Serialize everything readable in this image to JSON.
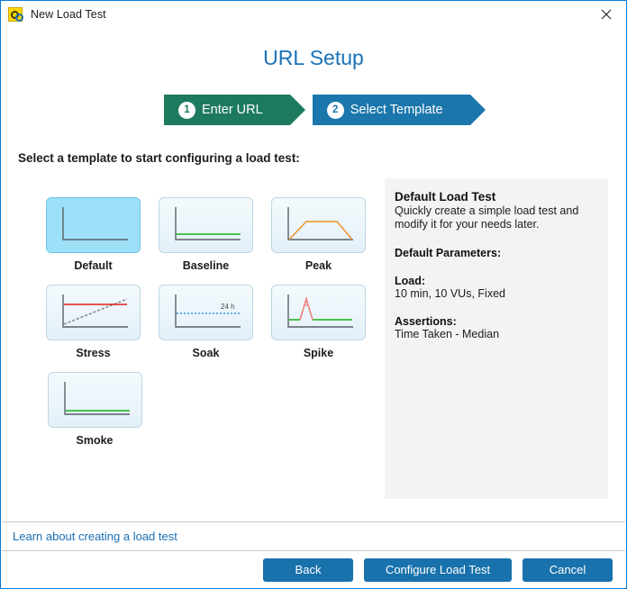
{
  "window": {
    "title": "New Load Test",
    "app_icon": "load-test-icon",
    "close_label": "✕",
    "border_color": "#0a78d4"
  },
  "header": {
    "page_title": "URL Setup"
  },
  "stepper": {
    "steps": [
      {
        "number": "1",
        "label": "Enter URL",
        "state": "done",
        "color": "#1d7a5f"
      },
      {
        "number": "2",
        "label": "Select Template",
        "state": "current",
        "color": "#1b76ac"
      }
    ]
  },
  "main": {
    "instruction": "Select a template to start configuring a load test:",
    "templates": [
      {
        "name": "Default",
        "selected": true,
        "thumb": "flat-baseline-plain"
      },
      {
        "name": "Baseline",
        "selected": false,
        "thumb": "flat-green-line"
      },
      {
        "name": "Peak",
        "selected": false,
        "thumb": "trapezoid-orange"
      },
      {
        "name": "Stress",
        "selected": false,
        "thumb": "ramp-up-red-threshold"
      },
      {
        "name": "Soak",
        "selected": false,
        "thumb": "long-dotted-blue",
        "annotation": "24 h"
      },
      {
        "name": "Spike",
        "selected": false,
        "thumb": "spike-red-green"
      },
      {
        "name": "Smoke",
        "selected": false,
        "thumb": "short-green-line"
      }
    ]
  },
  "detail": {
    "title": "Default Load Test",
    "description": "Quickly create a simple load test and modify it for your needs later.",
    "parameters_heading": "Default Parameters:",
    "load_heading": "Load:",
    "load_value": "10 min, 10 VUs, Fixed",
    "assertions_heading": "Assertions:",
    "assertions_value": "Time Taken - Median"
  },
  "footer": {
    "learn_link": "Learn about creating a load test",
    "back_label": "Back",
    "configure_label": "Configure Load Test",
    "cancel_label": "Cancel",
    "button_color": "#1a72ac"
  }
}
